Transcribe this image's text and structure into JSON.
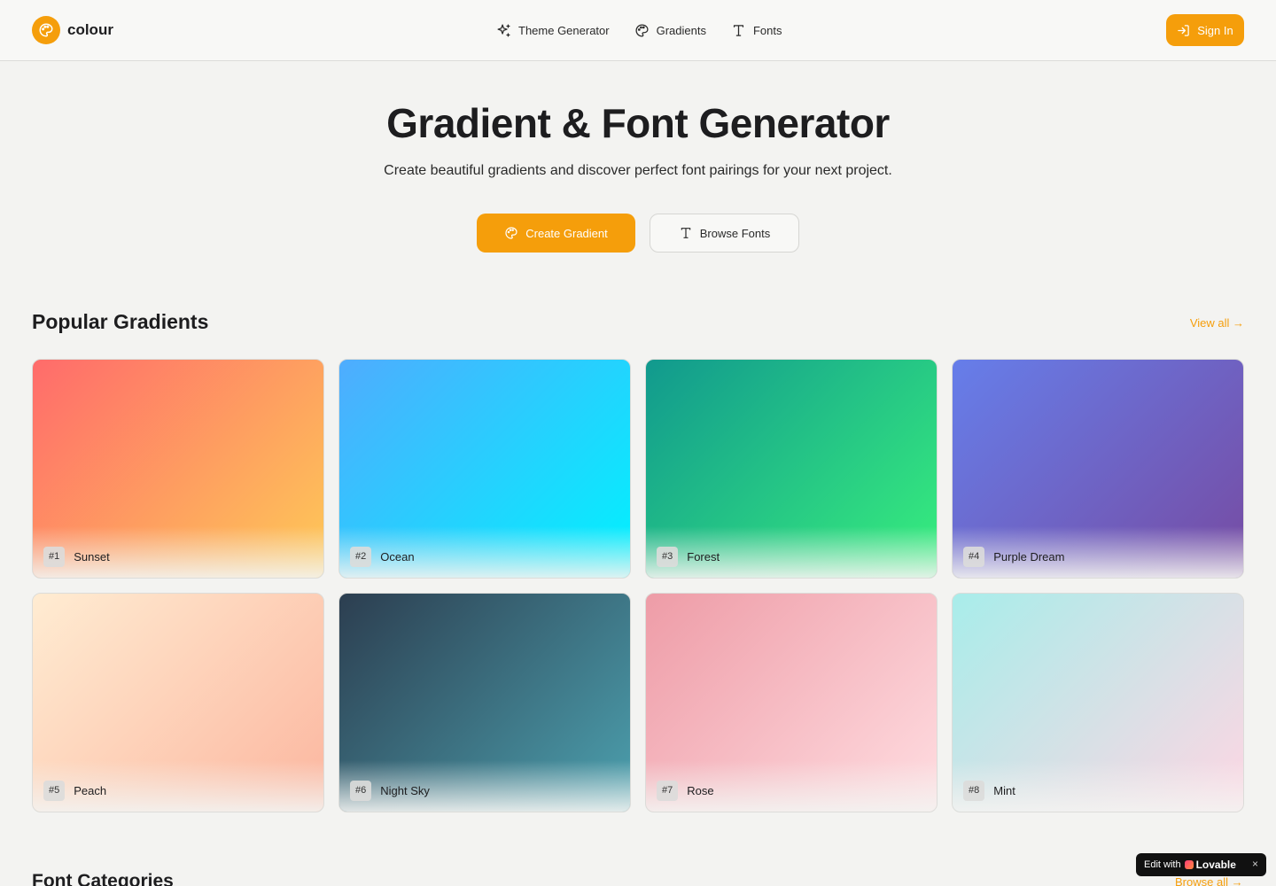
{
  "header": {
    "logo_text": "colour",
    "nav": [
      {
        "label": "Theme Generator",
        "icon": "sparkles-icon"
      },
      {
        "label": "Gradients",
        "icon": "palette-icon"
      },
      {
        "label": "Fonts",
        "icon": "type-icon"
      }
    ],
    "signin_label": "Sign In"
  },
  "hero": {
    "title": "Gradient & Font Generator",
    "subtitle": "Create beautiful gradients and discover perfect font pairings for your next project.",
    "primary_button": "Create Gradient",
    "secondary_button": "Browse Fonts"
  },
  "gradients_section": {
    "title": "Popular Gradients",
    "view_all": "View all →",
    "cards": [
      {
        "num": "#1",
        "name": "Sunset",
        "from": "#ff6b6b",
        "to": "#feca57"
      },
      {
        "num": "#2",
        "name": "Ocean",
        "from": "#4facfe",
        "to": "#00f2fe"
      },
      {
        "num": "#3",
        "name": "Forest",
        "from": "#11998e",
        "to": "#38ef7d"
      },
      {
        "num": "#4",
        "name": "Purple Dream",
        "from": "#667eea",
        "to": "#764ba2"
      },
      {
        "num": "#5",
        "name": "Peach",
        "from": "#ffecd2",
        "to": "#fcb69f"
      },
      {
        "num": "#6",
        "name": "Night Sky",
        "from": "#2c3e50",
        "to": "#4ca1af"
      },
      {
        "num": "#7",
        "name": "Rose",
        "from": "#ee9ca7",
        "to": "#ffdde1"
      },
      {
        "num": "#8",
        "name": "Mint",
        "from": "#a8edea",
        "to": "#fed6e3"
      }
    ]
  },
  "fonts_section": {
    "title": "Font Categories",
    "browse_all": "Browse all →"
  },
  "badge": {
    "prefix": "Edit with",
    "brand": "Lovable",
    "close": "×"
  },
  "colors": {
    "accent": "#f59e0b",
    "background": "#f3f3f1"
  }
}
